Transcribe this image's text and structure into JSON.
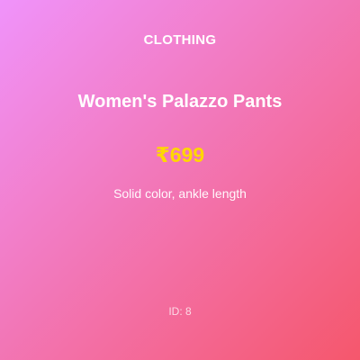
{
  "product": {
    "category": "CLOTHING",
    "title": "Women's Palazzo Pants",
    "price": "₹699",
    "description": "Solid color, ankle length",
    "id_label": "ID: 8"
  },
  "colors": {
    "gradient_start": "#f093fb",
    "gradient_end": "#f5576c",
    "price": "#ffd700",
    "text": "#ffffff"
  }
}
